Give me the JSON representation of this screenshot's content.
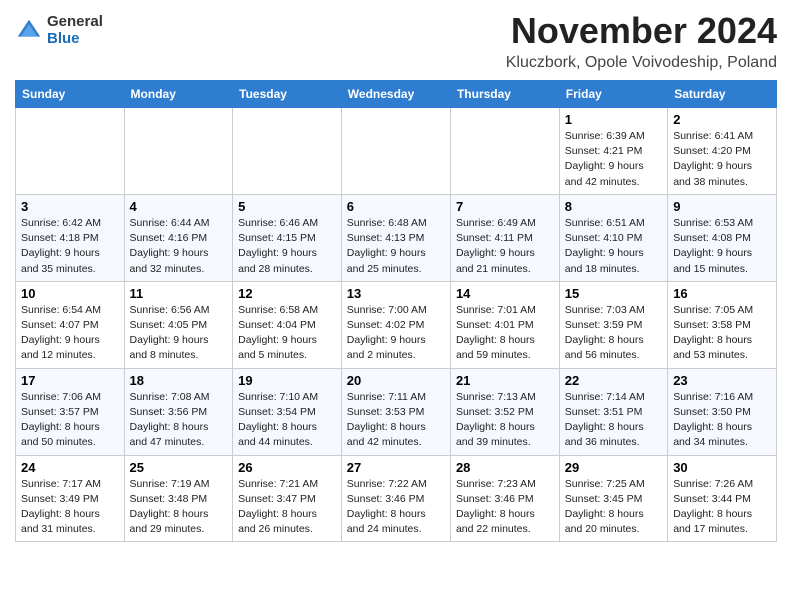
{
  "logo": {
    "general": "General",
    "blue": "Blue"
  },
  "title": "November 2024",
  "location": "Kluczbork, Opole Voivodeship, Poland",
  "headers": [
    "Sunday",
    "Monday",
    "Tuesday",
    "Wednesday",
    "Thursday",
    "Friday",
    "Saturday"
  ],
  "weeks": [
    {
      "days": [
        {
          "num": "",
          "info": ""
        },
        {
          "num": "",
          "info": ""
        },
        {
          "num": "",
          "info": ""
        },
        {
          "num": "",
          "info": ""
        },
        {
          "num": "",
          "info": ""
        },
        {
          "num": "1",
          "info": "Sunrise: 6:39 AM\nSunset: 4:21 PM\nDaylight: 9 hours\nand 42 minutes."
        },
        {
          "num": "2",
          "info": "Sunrise: 6:41 AM\nSunset: 4:20 PM\nDaylight: 9 hours\nand 38 minutes."
        }
      ]
    },
    {
      "days": [
        {
          "num": "3",
          "info": "Sunrise: 6:42 AM\nSunset: 4:18 PM\nDaylight: 9 hours\nand 35 minutes."
        },
        {
          "num": "4",
          "info": "Sunrise: 6:44 AM\nSunset: 4:16 PM\nDaylight: 9 hours\nand 32 minutes."
        },
        {
          "num": "5",
          "info": "Sunrise: 6:46 AM\nSunset: 4:15 PM\nDaylight: 9 hours\nand 28 minutes."
        },
        {
          "num": "6",
          "info": "Sunrise: 6:48 AM\nSunset: 4:13 PM\nDaylight: 9 hours\nand 25 minutes."
        },
        {
          "num": "7",
          "info": "Sunrise: 6:49 AM\nSunset: 4:11 PM\nDaylight: 9 hours\nand 21 minutes."
        },
        {
          "num": "8",
          "info": "Sunrise: 6:51 AM\nSunset: 4:10 PM\nDaylight: 9 hours\nand 18 minutes."
        },
        {
          "num": "9",
          "info": "Sunrise: 6:53 AM\nSunset: 4:08 PM\nDaylight: 9 hours\nand 15 minutes."
        }
      ]
    },
    {
      "days": [
        {
          "num": "10",
          "info": "Sunrise: 6:54 AM\nSunset: 4:07 PM\nDaylight: 9 hours\nand 12 minutes."
        },
        {
          "num": "11",
          "info": "Sunrise: 6:56 AM\nSunset: 4:05 PM\nDaylight: 9 hours\nand 8 minutes."
        },
        {
          "num": "12",
          "info": "Sunrise: 6:58 AM\nSunset: 4:04 PM\nDaylight: 9 hours\nand 5 minutes."
        },
        {
          "num": "13",
          "info": "Sunrise: 7:00 AM\nSunset: 4:02 PM\nDaylight: 9 hours\nand 2 minutes."
        },
        {
          "num": "14",
          "info": "Sunrise: 7:01 AM\nSunset: 4:01 PM\nDaylight: 8 hours\nand 59 minutes."
        },
        {
          "num": "15",
          "info": "Sunrise: 7:03 AM\nSunset: 3:59 PM\nDaylight: 8 hours\nand 56 minutes."
        },
        {
          "num": "16",
          "info": "Sunrise: 7:05 AM\nSunset: 3:58 PM\nDaylight: 8 hours\nand 53 minutes."
        }
      ]
    },
    {
      "days": [
        {
          "num": "17",
          "info": "Sunrise: 7:06 AM\nSunset: 3:57 PM\nDaylight: 8 hours\nand 50 minutes."
        },
        {
          "num": "18",
          "info": "Sunrise: 7:08 AM\nSunset: 3:56 PM\nDaylight: 8 hours\nand 47 minutes."
        },
        {
          "num": "19",
          "info": "Sunrise: 7:10 AM\nSunset: 3:54 PM\nDaylight: 8 hours\nand 44 minutes."
        },
        {
          "num": "20",
          "info": "Sunrise: 7:11 AM\nSunset: 3:53 PM\nDaylight: 8 hours\nand 42 minutes."
        },
        {
          "num": "21",
          "info": "Sunrise: 7:13 AM\nSunset: 3:52 PM\nDaylight: 8 hours\nand 39 minutes."
        },
        {
          "num": "22",
          "info": "Sunrise: 7:14 AM\nSunset: 3:51 PM\nDaylight: 8 hours\nand 36 minutes."
        },
        {
          "num": "23",
          "info": "Sunrise: 7:16 AM\nSunset: 3:50 PM\nDaylight: 8 hours\nand 34 minutes."
        }
      ]
    },
    {
      "days": [
        {
          "num": "24",
          "info": "Sunrise: 7:17 AM\nSunset: 3:49 PM\nDaylight: 8 hours\nand 31 minutes."
        },
        {
          "num": "25",
          "info": "Sunrise: 7:19 AM\nSunset: 3:48 PM\nDaylight: 8 hours\nand 29 minutes."
        },
        {
          "num": "26",
          "info": "Sunrise: 7:21 AM\nSunset: 3:47 PM\nDaylight: 8 hours\nand 26 minutes."
        },
        {
          "num": "27",
          "info": "Sunrise: 7:22 AM\nSunset: 3:46 PM\nDaylight: 8 hours\nand 24 minutes."
        },
        {
          "num": "28",
          "info": "Sunrise: 7:23 AM\nSunset: 3:46 PM\nDaylight: 8 hours\nand 22 minutes."
        },
        {
          "num": "29",
          "info": "Sunrise: 7:25 AM\nSunset: 3:45 PM\nDaylight: 8 hours\nand 20 minutes."
        },
        {
          "num": "30",
          "info": "Sunrise: 7:26 AM\nSunset: 3:44 PM\nDaylight: 8 hours\nand 17 minutes."
        }
      ]
    }
  ]
}
